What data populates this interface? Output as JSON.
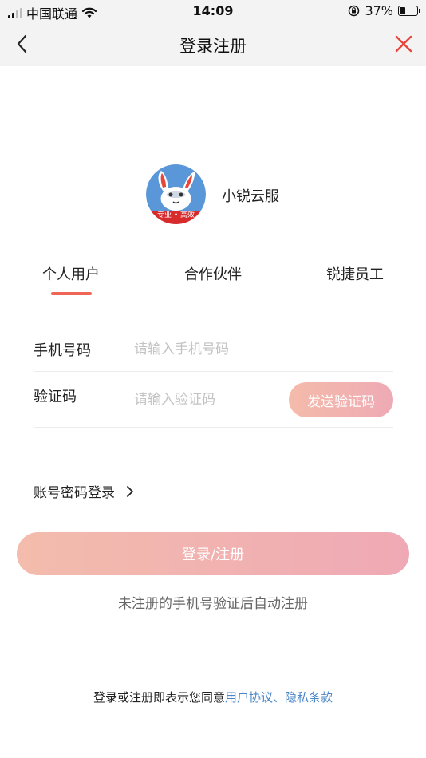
{
  "status_bar": {
    "carrier": "中国联通",
    "time": "14:09",
    "battery_percent": "37%",
    "battery_level": 0.37,
    "icons": [
      "signal-icon",
      "wifi-icon",
      "rotation-lock-icon",
      "battery-icon"
    ]
  },
  "nav": {
    "title": "登录注册",
    "back_icon": "chevron-left-icon",
    "close_icon": "close-icon",
    "close_color": "#e8453c"
  },
  "brand": {
    "name": "小锐云服",
    "logo_badge": "专业 • 高效",
    "logo_colors": {
      "background": "#5a97d8",
      "banner": "#d82c2c"
    }
  },
  "tabs": {
    "items": [
      "个人用户",
      "合作伙伴",
      "锐捷员工"
    ],
    "active_index": 0,
    "indicator_color": "#ef6556"
  },
  "form": {
    "phone": {
      "label": "手机号码",
      "placeholder": "请输入手机号码",
      "value": ""
    },
    "code": {
      "label": "验证码",
      "placeholder": "请输入验证码",
      "value": ""
    },
    "send_code_label": "发送验证码"
  },
  "password_login": {
    "label": "账号密码登录"
  },
  "submit": {
    "label": "登录/注册"
  },
  "auto_register_tip": "未注册的手机号验证后自动注册",
  "agreement": {
    "prefix": "登录或注册即表示您同意",
    "user_agreement": "用户协议",
    "separator": "、",
    "privacy_policy": "隐私条款",
    "link_color": "#4c86c6"
  }
}
